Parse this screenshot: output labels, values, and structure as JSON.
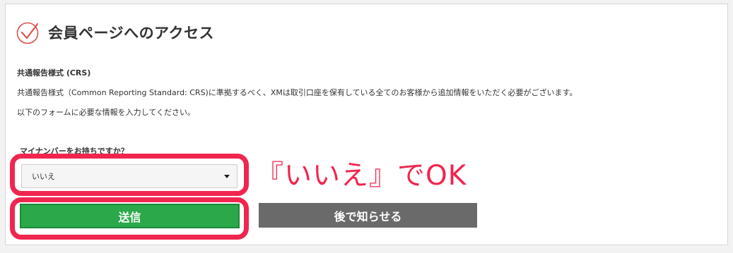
{
  "header": {
    "title": "会員ページへのアクセス",
    "icon": "check-circle-icon"
  },
  "section": {
    "title": "共通報告様式 (CRS)",
    "description": "共通報告様式（Common Reporting Standard: CRS)に準拠するべく、XMは取引口座を保有している全てのお客様から追加情報をいただく必要がございます。",
    "instruction": "以下のフォームに必要な情報を入力してください。"
  },
  "form": {
    "question": "マイナンバーをお持ちですか？",
    "select_value": "いいえ",
    "submit_label": "送信",
    "later_label": "後で知らせる"
  },
  "annotation": {
    "text": "『いいえ』でOK"
  },
  "colors": {
    "accent_red": "#f0264f",
    "submit_green": "#2aa84a",
    "later_gray": "#6a6a6a",
    "icon_red": "#d9534f"
  }
}
